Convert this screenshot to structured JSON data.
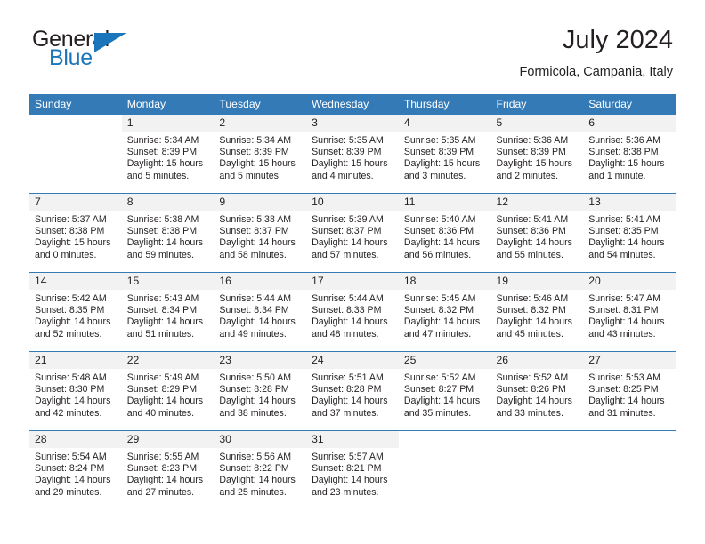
{
  "brand": {
    "name_part1": "General",
    "name_part2": "Blue",
    "accent_color": "#1b75bb"
  },
  "header": {
    "title": "July 2024",
    "subtitle": "Formicola, Campania, Italy",
    "header_bg_color": "#337ab7"
  },
  "weekdays": [
    "Sunday",
    "Monday",
    "Tuesday",
    "Wednesday",
    "Thursday",
    "Friday",
    "Saturday"
  ],
  "labels": {
    "sunrise_prefix": "Sunrise:",
    "sunset_prefix": "Sunset:",
    "daylight_prefix": "Daylight:"
  },
  "weeks": [
    [
      {
        "day": "",
        "sunrise": "",
        "sunset": "",
        "daylight_line1": "",
        "daylight_line2": ""
      },
      {
        "day": "1",
        "sunrise": "Sunrise: 5:34 AM",
        "sunset": "Sunset: 8:39 PM",
        "daylight_line1": "Daylight: 15 hours",
        "daylight_line2": "and 5 minutes."
      },
      {
        "day": "2",
        "sunrise": "Sunrise: 5:34 AM",
        "sunset": "Sunset: 8:39 PM",
        "daylight_line1": "Daylight: 15 hours",
        "daylight_line2": "and 5 minutes."
      },
      {
        "day": "3",
        "sunrise": "Sunrise: 5:35 AM",
        "sunset": "Sunset: 8:39 PM",
        "daylight_line1": "Daylight: 15 hours",
        "daylight_line2": "and 4 minutes."
      },
      {
        "day": "4",
        "sunrise": "Sunrise: 5:35 AM",
        "sunset": "Sunset: 8:39 PM",
        "daylight_line1": "Daylight: 15 hours",
        "daylight_line2": "and 3 minutes."
      },
      {
        "day": "5",
        "sunrise": "Sunrise: 5:36 AM",
        "sunset": "Sunset: 8:39 PM",
        "daylight_line1": "Daylight: 15 hours",
        "daylight_line2": "and 2 minutes."
      },
      {
        "day": "6",
        "sunrise": "Sunrise: 5:36 AM",
        "sunset": "Sunset: 8:38 PM",
        "daylight_line1": "Daylight: 15 hours",
        "daylight_line2": "and 1 minute."
      }
    ],
    [
      {
        "day": "7",
        "sunrise": "Sunrise: 5:37 AM",
        "sunset": "Sunset: 8:38 PM",
        "daylight_line1": "Daylight: 15 hours",
        "daylight_line2": "and 0 minutes."
      },
      {
        "day": "8",
        "sunrise": "Sunrise: 5:38 AM",
        "sunset": "Sunset: 8:38 PM",
        "daylight_line1": "Daylight: 14 hours",
        "daylight_line2": "and 59 minutes."
      },
      {
        "day": "9",
        "sunrise": "Sunrise: 5:38 AM",
        "sunset": "Sunset: 8:37 PM",
        "daylight_line1": "Daylight: 14 hours",
        "daylight_line2": "and 58 minutes."
      },
      {
        "day": "10",
        "sunrise": "Sunrise: 5:39 AM",
        "sunset": "Sunset: 8:37 PM",
        "daylight_line1": "Daylight: 14 hours",
        "daylight_line2": "and 57 minutes."
      },
      {
        "day": "11",
        "sunrise": "Sunrise: 5:40 AM",
        "sunset": "Sunset: 8:36 PM",
        "daylight_line1": "Daylight: 14 hours",
        "daylight_line2": "and 56 minutes."
      },
      {
        "day": "12",
        "sunrise": "Sunrise: 5:41 AM",
        "sunset": "Sunset: 8:36 PM",
        "daylight_line1": "Daylight: 14 hours",
        "daylight_line2": "and 55 minutes."
      },
      {
        "day": "13",
        "sunrise": "Sunrise: 5:41 AM",
        "sunset": "Sunset: 8:35 PM",
        "daylight_line1": "Daylight: 14 hours",
        "daylight_line2": "and 54 minutes."
      }
    ],
    [
      {
        "day": "14",
        "sunrise": "Sunrise: 5:42 AM",
        "sunset": "Sunset: 8:35 PM",
        "daylight_line1": "Daylight: 14 hours",
        "daylight_line2": "and 52 minutes."
      },
      {
        "day": "15",
        "sunrise": "Sunrise: 5:43 AM",
        "sunset": "Sunset: 8:34 PM",
        "daylight_line1": "Daylight: 14 hours",
        "daylight_line2": "and 51 minutes."
      },
      {
        "day": "16",
        "sunrise": "Sunrise: 5:44 AM",
        "sunset": "Sunset: 8:34 PM",
        "daylight_line1": "Daylight: 14 hours",
        "daylight_line2": "and 49 minutes."
      },
      {
        "day": "17",
        "sunrise": "Sunrise: 5:44 AM",
        "sunset": "Sunset: 8:33 PM",
        "daylight_line1": "Daylight: 14 hours",
        "daylight_line2": "and 48 minutes."
      },
      {
        "day": "18",
        "sunrise": "Sunrise: 5:45 AM",
        "sunset": "Sunset: 8:32 PM",
        "daylight_line1": "Daylight: 14 hours",
        "daylight_line2": "and 47 minutes."
      },
      {
        "day": "19",
        "sunrise": "Sunrise: 5:46 AM",
        "sunset": "Sunset: 8:32 PM",
        "daylight_line1": "Daylight: 14 hours",
        "daylight_line2": "and 45 minutes."
      },
      {
        "day": "20",
        "sunrise": "Sunrise: 5:47 AM",
        "sunset": "Sunset: 8:31 PM",
        "daylight_line1": "Daylight: 14 hours",
        "daylight_line2": "and 43 minutes."
      }
    ],
    [
      {
        "day": "21",
        "sunrise": "Sunrise: 5:48 AM",
        "sunset": "Sunset: 8:30 PM",
        "daylight_line1": "Daylight: 14 hours",
        "daylight_line2": "and 42 minutes."
      },
      {
        "day": "22",
        "sunrise": "Sunrise: 5:49 AM",
        "sunset": "Sunset: 8:29 PM",
        "daylight_line1": "Daylight: 14 hours",
        "daylight_line2": "and 40 minutes."
      },
      {
        "day": "23",
        "sunrise": "Sunrise: 5:50 AM",
        "sunset": "Sunset: 8:28 PM",
        "daylight_line1": "Daylight: 14 hours",
        "daylight_line2": "and 38 minutes."
      },
      {
        "day": "24",
        "sunrise": "Sunrise: 5:51 AM",
        "sunset": "Sunset: 8:28 PM",
        "daylight_line1": "Daylight: 14 hours",
        "daylight_line2": "and 37 minutes."
      },
      {
        "day": "25",
        "sunrise": "Sunrise: 5:52 AM",
        "sunset": "Sunset: 8:27 PM",
        "daylight_line1": "Daylight: 14 hours",
        "daylight_line2": "and 35 minutes."
      },
      {
        "day": "26",
        "sunrise": "Sunrise: 5:52 AM",
        "sunset": "Sunset: 8:26 PM",
        "daylight_line1": "Daylight: 14 hours",
        "daylight_line2": "and 33 minutes."
      },
      {
        "day": "27",
        "sunrise": "Sunrise: 5:53 AM",
        "sunset": "Sunset: 8:25 PM",
        "daylight_line1": "Daylight: 14 hours",
        "daylight_line2": "and 31 minutes."
      }
    ],
    [
      {
        "day": "28",
        "sunrise": "Sunrise: 5:54 AM",
        "sunset": "Sunset: 8:24 PM",
        "daylight_line1": "Daylight: 14 hours",
        "daylight_line2": "and 29 minutes."
      },
      {
        "day": "29",
        "sunrise": "Sunrise: 5:55 AM",
        "sunset": "Sunset: 8:23 PM",
        "daylight_line1": "Daylight: 14 hours",
        "daylight_line2": "and 27 minutes."
      },
      {
        "day": "30",
        "sunrise": "Sunrise: 5:56 AM",
        "sunset": "Sunset: 8:22 PM",
        "daylight_line1": "Daylight: 14 hours",
        "daylight_line2": "and 25 minutes."
      },
      {
        "day": "31",
        "sunrise": "Sunrise: 5:57 AM",
        "sunset": "Sunset: 8:21 PM",
        "daylight_line1": "Daylight: 14 hours",
        "daylight_line2": "and 23 minutes."
      },
      {
        "day": "",
        "sunrise": "",
        "sunset": "",
        "daylight_line1": "",
        "daylight_line2": ""
      },
      {
        "day": "",
        "sunrise": "",
        "sunset": "",
        "daylight_line1": "",
        "daylight_line2": ""
      },
      {
        "day": "",
        "sunrise": "",
        "sunset": "",
        "daylight_line1": "",
        "daylight_line2": ""
      }
    ]
  ]
}
